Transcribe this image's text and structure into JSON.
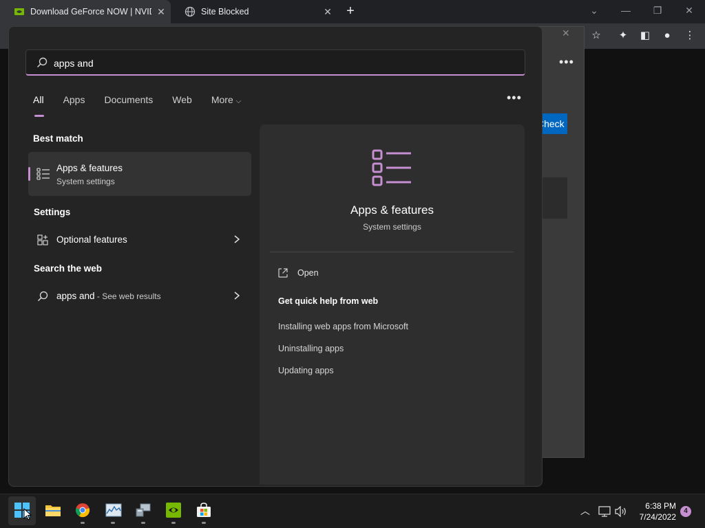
{
  "browser": {
    "tabs": [
      {
        "title": "Download GeForce NOW | NVIDIA",
        "active": true
      },
      {
        "title": "Site Blocked",
        "active": false
      }
    ],
    "new_tab_symbol": "+",
    "window_controls": [
      "chevron-down",
      "minimize",
      "restore",
      "close"
    ]
  },
  "blocked_page": {
    "button_label": "Check for updates"
  },
  "search": {
    "query": "apps and",
    "filter_tabs": [
      "All",
      "Apps",
      "Documents",
      "Web",
      "More"
    ],
    "active_tab": "All",
    "accent_color": "#c58fd1"
  },
  "results": {
    "best_match_heading": "Best match",
    "best_match": {
      "title": "Apps & features",
      "subtitle": "System settings",
      "icon": "list-settings-icon"
    },
    "settings_heading": "Settings",
    "settings_items": [
      {
        "label": "Optional features",
        "icon": "grid-plus-icon"
      }
    ],
    "web_heading": "Search the web",
    "web_item": {
      "query": "apps and",
      "suffix": " - See web results",
      "icon": "search-icon"
    }
  },
  "preview": {
    "title": "Apps & features",
    "subtitle": "System settings",
    "open_label": "Open",
    "help_heading": "Get quick help from web",
    "help_links": [
      "Installing web apps from Microsoft",
      "Uninstalling apps",
      "Updating apps"
    ]
  },
  "taskbar": {
    "apps": [
      "start",
      "file-explorer",
      "chrome",
      "resource-monitor",
      "computer-management",
      "nvidia",
      "microsoft-store"
    ],
    "time": "6:38 PM",
    "date": "7/24/2022",
    "notification_count": "4"
  }
}
